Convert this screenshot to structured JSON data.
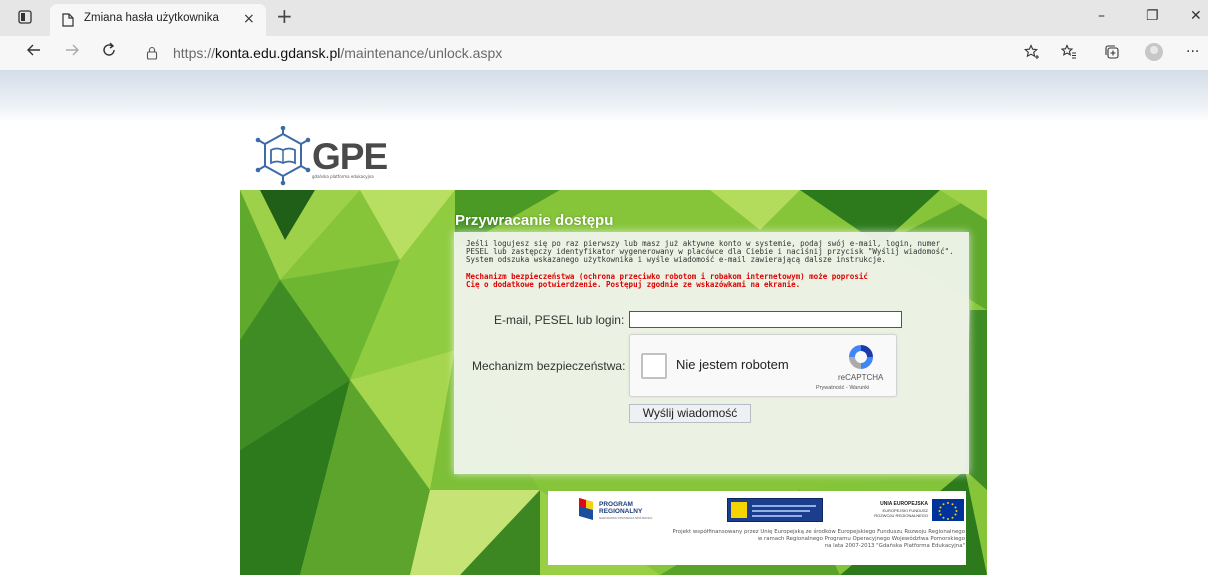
{
  "browser": {
    "tab_title": "Zmiana hasła użytkownika",
    "tab_close": "×",
    "new_tab": "+",
    "url_scheme": "https://",
    "url_host": "konta.edu.gdansk.pl",
    "url_path": "/maintenance/unlock.aspx",
    "minimize": "–",
    "restore": "❐",
    "close": "✕",
    "more": "···"
  },
  "logo": {
    "text": "GPE",
    "subtitle": "gdańska platforma edukacyjna"
  },
  "form": {
    "heading": "Przywracanie dostępu",
    "intro_1": "Jeśli logujesz się po raz pierwszy lub masz już aktywne konto w systemie, podaj swój e-mail, login, numer",
    "intro_2": "PESEL lub zastępczy identyfikator wygenerowany w placówce dla Ciebie i naciśnij przycisk \"Wyślij wiadomość\".",
    "intro_3": "System odszuka wskazanego użytkownika i wyśle wiadomość e-mail zawierającą dalsze instrukcje.",
    "warn_1": "Mechanizm bezpieczeństwa (ochrona przeciwko robotom i robakom internetowym) może poprosić",
    "warn_2": "Cię o dodatkowe potwierdzenie. Postępuj zgodnie ze wskazówkami na ekranie.",
    "login_label": "E-mail, PESEL lub login:",
    "login_value": "",
    "security_label": "Mechanizm bezpieczeństwa:",
    "captcha_text": "Nie jestem robotem",
    "captcha_brand": "reCAPTCHA",
    "captcha_links": "Prywatność - Warunki",
    "send_button": "Wyślij wiadomość"
  },
  "footer": {
    "program_1": "PROGRAM",
    "program_2": "REGIONALNY",
    "program_3": "NARODOWA STRATEGIA SPÓJNOŚCI",
    "eu_1": "UNIA EUROPEJSKA",
    "eu_2": "EUROPEJSKI FUNDUSZ",
    "eu_3": "ROZWOJU REGIONALNEGO",
    "line_1": "Projekt współfinansowany przez Unię Europejską ze środków Europejskiego Funduszu Rozwoju Regionalnego",
    "line_2": "w ramach Regionalnego Programu Operacyjnego Województwa Pomorskiego",
    "line_3": "na lata 2007-2013 \"Gdańska Platforma Edukacyjna\""
  },
  "colors": {
    "green_main": "#7fc236",
    "green_dark": "#2f7d1f",
    "warning_red": "#e00000",
    "eu_blue": "#003399"
  }
}
